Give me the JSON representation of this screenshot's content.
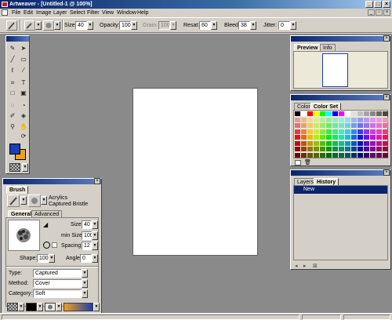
{
  "window": {
    "title": "Artweaver - [Untitled-1 @ 100%]",
    "min": "_",
    "max": "□",
    "close": "×"
  },
  "menu": [
    "File",
    "Edit",
    "Image",
    "Layer",
    "Select",
    "Filter",
    "View",
    "Window",
    "Help"
  ],
  "options": {
    "size_label": "Size:",
    "size_value": "40",
    "opacity_label": "Opacity:",
    "opacity_value": "100",
    "grain_label": "Grain:",
    "grain_value": "100",
    "resat_label": "Resat:",
    "resat_value": "60",
    "bleed_label": "Bleed:",
    "bleed_value": "38",
    "jitter_label": "Jitter:",
    "jitter_value": "0"
  },
  "preview_panel": {
    "tabs": [
      "Preview",
      "Info"
    ]
  },
  "color_panel": {
    "tabs": [
      "Color",
      "Color Set"
    ]
  },
  "history_panel": {
    "tabs": [
      "Layers",
      "History"
    ],
    "rows": [
      "New"
    ]
  },
  "brush_panel": {
    "title": "Brush",
    "category_name": "Acrylics",
    "variant_name": "Captured Bristle",
    "tabs": [
      "General",
      "Advanced"
    ],
    "size_label": "Size:",
    "size_value": "40",
    "min_size_label": "min Size:",
    "min_size_value": "100",
    "spacing_label": "Spacing:",
    "spacing_value": "12",
    "shape_label": "Shape:",
    "shape_value": "100",
    "angle_label": "Angle:",
    "angle_value": "0",
    "type_label": "Type:",
    "type_value": "Captured",
    "method_label": "Method:",
    "method_value": "Cover",
    "category_label": "Category:",
    "category_value": "Soft"
  },
  "colors": {
    "primary": "#1a3fb0",
    "secondary": "#f0a020",
    "title_active": "#0a246a",
    "workspace": "#8a8a8a"
  }
}
